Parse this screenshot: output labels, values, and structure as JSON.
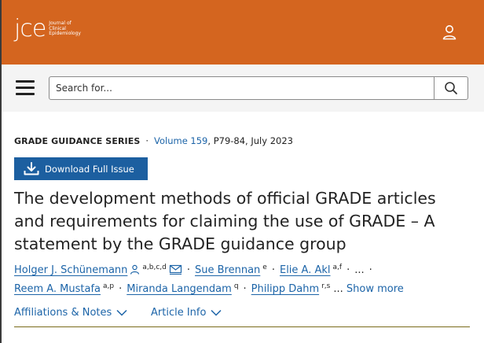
{
  "header": {
    "logo_mark": "jce",
    "logo_sub": [
      "Journal of",
      "Clinical",
      "Epidemiology"
    ],
    "brand_color": "#d4651f",
    "user_icon": "user-icon"
  },
  "nav": {
    "menu_icon": "hamburger-menu-icon",
    "search_placeholder": "Search for...",
    "search_icon": "search-icon"
  },
  "article": {
    "series": "GRADE GUIDANCE SERIES",
    "volume_link": "Volume 159",
    "pages_date": ", P79-84, July 2023",
    "download_label": "Download Full Issue",
    "title": "The development methods of official GRADE articles and requirements for claiming the use of GRADE – A statement by the GRADE guidance group",
    "authors": [
      {
        "name": "Holger J. Schünemann",
        "sup": "a,b,c,d"
      },
      {
        "name": "Sue Brennan",
        "sup": "e"
      },
      {
        "name": "Elie A. Akl",
        "sup": "a,f"
      },
      {
        "name": "Reem A. Mustafa",
        "sup": "a,p"
      },
      {
        "name": "Miranda Langendam",
        "sup": "q"
      },
      {
        "name": "Philipp Dahm",
        "sup": "r,s"
      }
    ],
    "ellipsis": "...",
    "show_more": "Show more",
    "affiliations_label": "Affiliations & Notes",
    "article_info_label": "Article Info"
  }
}
